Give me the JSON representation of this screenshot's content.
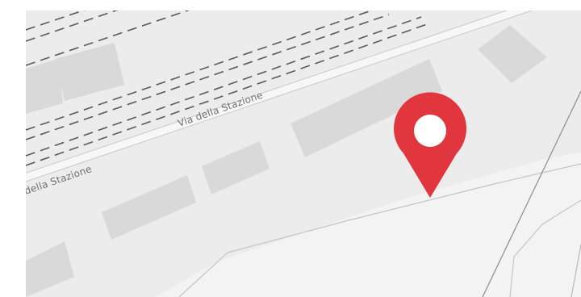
{
  "map": {
    "street_name": "Via della Stazione",
    "street_label_partial": "della Stazione",
    "marker": {
      "color": "#e2363f",
      "center_color": "#ffffff",
      "icon": "map-pin-icon"
    },
    "colors": {
      "land": "#ececec",
      "building": "#d9d9d9",
      "road": "#f6f6f6",
      "railway": "#5a5a5a",
      "outline": "#b9b9b9",
      "path": "#8d8d8d"
    }
  }
}
